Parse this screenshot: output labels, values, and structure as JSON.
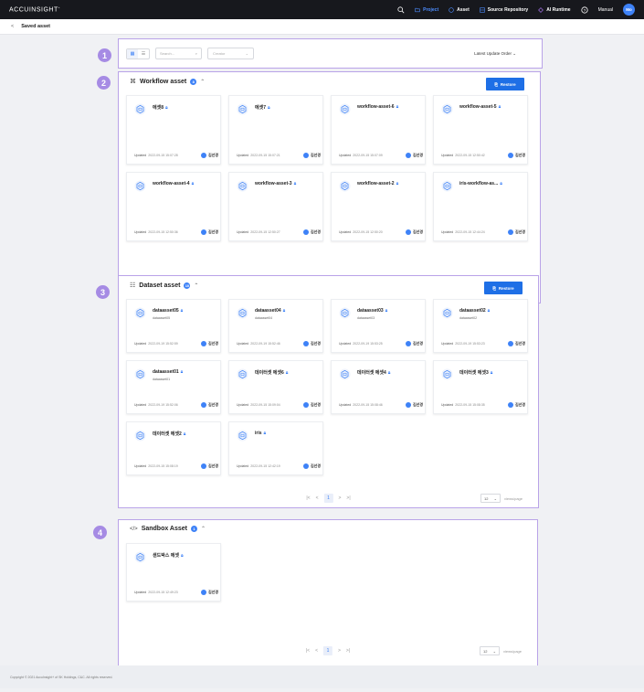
{
  "topbar": {
    "logo": "ACCUINSIGHT",
    "logo_mark": "+",
    "nav": [
      {
        "label": "Project",
        "icon": "folder-icon",
        "active": true
      },
      {
        "label": "Asset",
        "icon": "circle-icon",
        "active": false
      },
      {
        "label": "Source Repository",
        "icon": "repository-icon",
        "active": false
      },
      {
        "label": "AI Runtime",
        "icon": "diamond-icon",
        "active": false
      }
    ],
    "manual_label": "Manual",
    "avatar_initials": "Mo"
  },
  "subbar": {
    "back": "<",
    "title": "Saved asset"
  },
  "filters": {
    "search_placeholder": "Search...",
    "creator_placeholder": "Creator",
    "sort_label": "Latest Update Order"
  },
  "annotations": [
    "1",
    "2",
    "3",
    "4"
  ],
  "sections": [
    {
      "title": "Workflow asset",
      "count": "8",
      "restore_label": "Restore",
      "cards": [
        {
          "title": "에셋8",
          "sub": "",
          "updated": "Updated",
          "date": "2022-09-15 15:07:28",
          "owner": "김선경"
        },
        {
          "title": "에셋7",
          "sub": "",
          "updated": "Updated",
          "date": "2022-09-15 15:07:21",
          "owner": "김선경"
        },
        {
          "title": "workflow-asset-6",
          "sub": "",
          "updated": "Updated",
          "date": "2022-09-15 15:07:09",
          "owner": "김선경"
        },
        {
          "title": "workflow-asset-5",
          "sub": "",
          "updated": "Updated",
          "date": "2022-09-15 12:50:42",
          "owner": "김선경"
        },
        {
          "title": "workflow-asset-4",
          "sub": "",
          "updated": "Updated",
          "date": "2022-09-15 12:50:36",
          "owner": "김선경"
        },
        {
          "title": "workflow-asset-3",
          "sub": "",
          "updated": "Updated",
          "date": "2022-09-15 12:50:27",
          "owner": "김선경"
        },
        {
          "title": "workflow-asset-2",
          "sub": "",
          "updated": "Updated",
          "date": "2022-09-15 12:50:20",
          "owner": "김선경"
        },
        {
          "title": "iris-workflow-as...",
          "sub": "",
          "updated": "Updated",
          "date": "2022-09-15 12:44:24",
          "owner": "김선경"
        }
      ],
      "pager": {
        "current": "1",
        "per_page": "12",
        "per_page_label": "views/page"
      }
    },
    {
      "title": "Dataset asset",
      "count": "10",
      "restore_label": "Restore",
      "cards": [
        {
          "title": "dataasset05",
          "sub": "dataasset05",
          "updated": "Updated",
          "date": "2022-09-19 15:52:59",
          "owner": "김선경"
        },
        {
          "title": "dataasset04",
          "sub": "dataasset04",
          "updated": "Updated",
          "date": "2022-09-19 15:52:46",
          "owner": "김선경"
        },
        {
          "title": "dataasset03",
          "sub": "dataasset03",
          "updated": "Updated",
          "date": "2022-09-19 15:53:25",
          "owner": "김선경"
        },
        {
          "title": "dataasset02",
          "sub": "dataasset02",
          "updated": "Updated",
          "date": "2022-09-19 15:53:23",
          "owner": "김선경"
        },
        {
          "title": "dataasset01",
          "sub": "dataasset01",
          "updated": "Updated",
          "date": "2022-09-19 15:52:06",
          "owner": "김선경"
        },
        {
          "title": "데이터셋 에셋6",
          "sub": "",
          "updated": "Updated",
          "date": "2022-09-15 15:09:04",
          "owner": "김선경"
        },
        {
          "title": "데이터셋 에셋4",
          "sub": "",
          "updated": "Updated",
          "date": "2022-09-15 15:08:46",
          "owner": "김선경"
        },
        {
          "title": "데이터셋 에셋3",
          "sub": "",
          "updated": "Updated",
          "date": "2022-09-15 15:08:35",
          "owner": "김선경"
        },
        {
          "title": "데이터셋 에셋2",
          "sub": "",
          "updated": "Updated",
          "date": "2022-09-15 15:08:19",
          "owner": "김선경"
        },
        {
          "title": "iris",
          "sub": "",
          "updated": "Updated",
          "date": "2022-09-15 12:42:19",
          "owner": "김선경"
        }
      ],
      "pager": {
        "current": "1",
        "per_page": "12",
        "per_page_label": "views/page"
      }
    },
    {
      "title": "Sandbox Asset",
      "count": "1",
      "restore_label": "",
      "cards": [
        {
          "title": "샌드박스 에셋",
          "sub": "",
          "updated": "Updated",
          "date": "2022-09-15 12:49:23",
          "owner": "김선경"
        }
      ],
      "pager": {
        "current": "1",
        "per_page": "12",
        "per_page_label": "views/page"
      }
    }
  ],
  "footer": "Copyright © 2021 AccuInsight+ of SK Holdings, C&C. All rights reserved.",
  "colors": {
    "accent": "#3e82f7",
    "annotation": "#a68be4",
    "restore": "#1e6fe6"
  }
}
